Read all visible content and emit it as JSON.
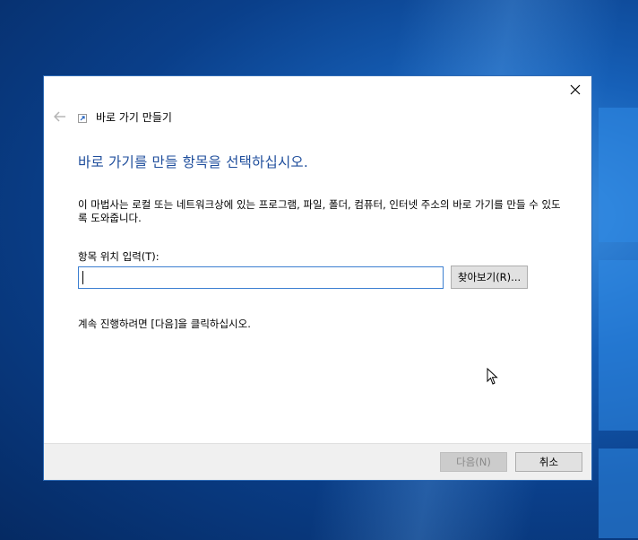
{
  "wizard": {
    "title": "바로 가기 만들기",
    "main_instruction": "바로 가기를 만들 항목을 선택하십시오.",
    "description": "이 마법사는 로컬 또는 네트워크상에 있는 프로그램, 파일, 폴더, 컴퓨터, 인터넷 주소의 바로 가기를 만들 수 있도록 도와줍니다.",
    "field_label": "항목 위치 입력(T):",
    "location_value": "",
    "browse_label": "찾아보기(R)...",
    "continue_text": "계속 진행하려면 [다음]을 클릭하십시오.",
    "next_label": "다음(N)",
    "cancel_label": "취소"
  },
  "icons": {
    "close": "close-icon",
    "back": "back-arrow-icon",
    "shortcut": "shortcut-icon",
    "cursor": "mouse-pointer-icon"
  },
  "colors": {
    "instruction": "#1f4e9c",
    "input_border": "#3c7fd1",
    "dialog_border": "#2f6bb5"
  }
}
